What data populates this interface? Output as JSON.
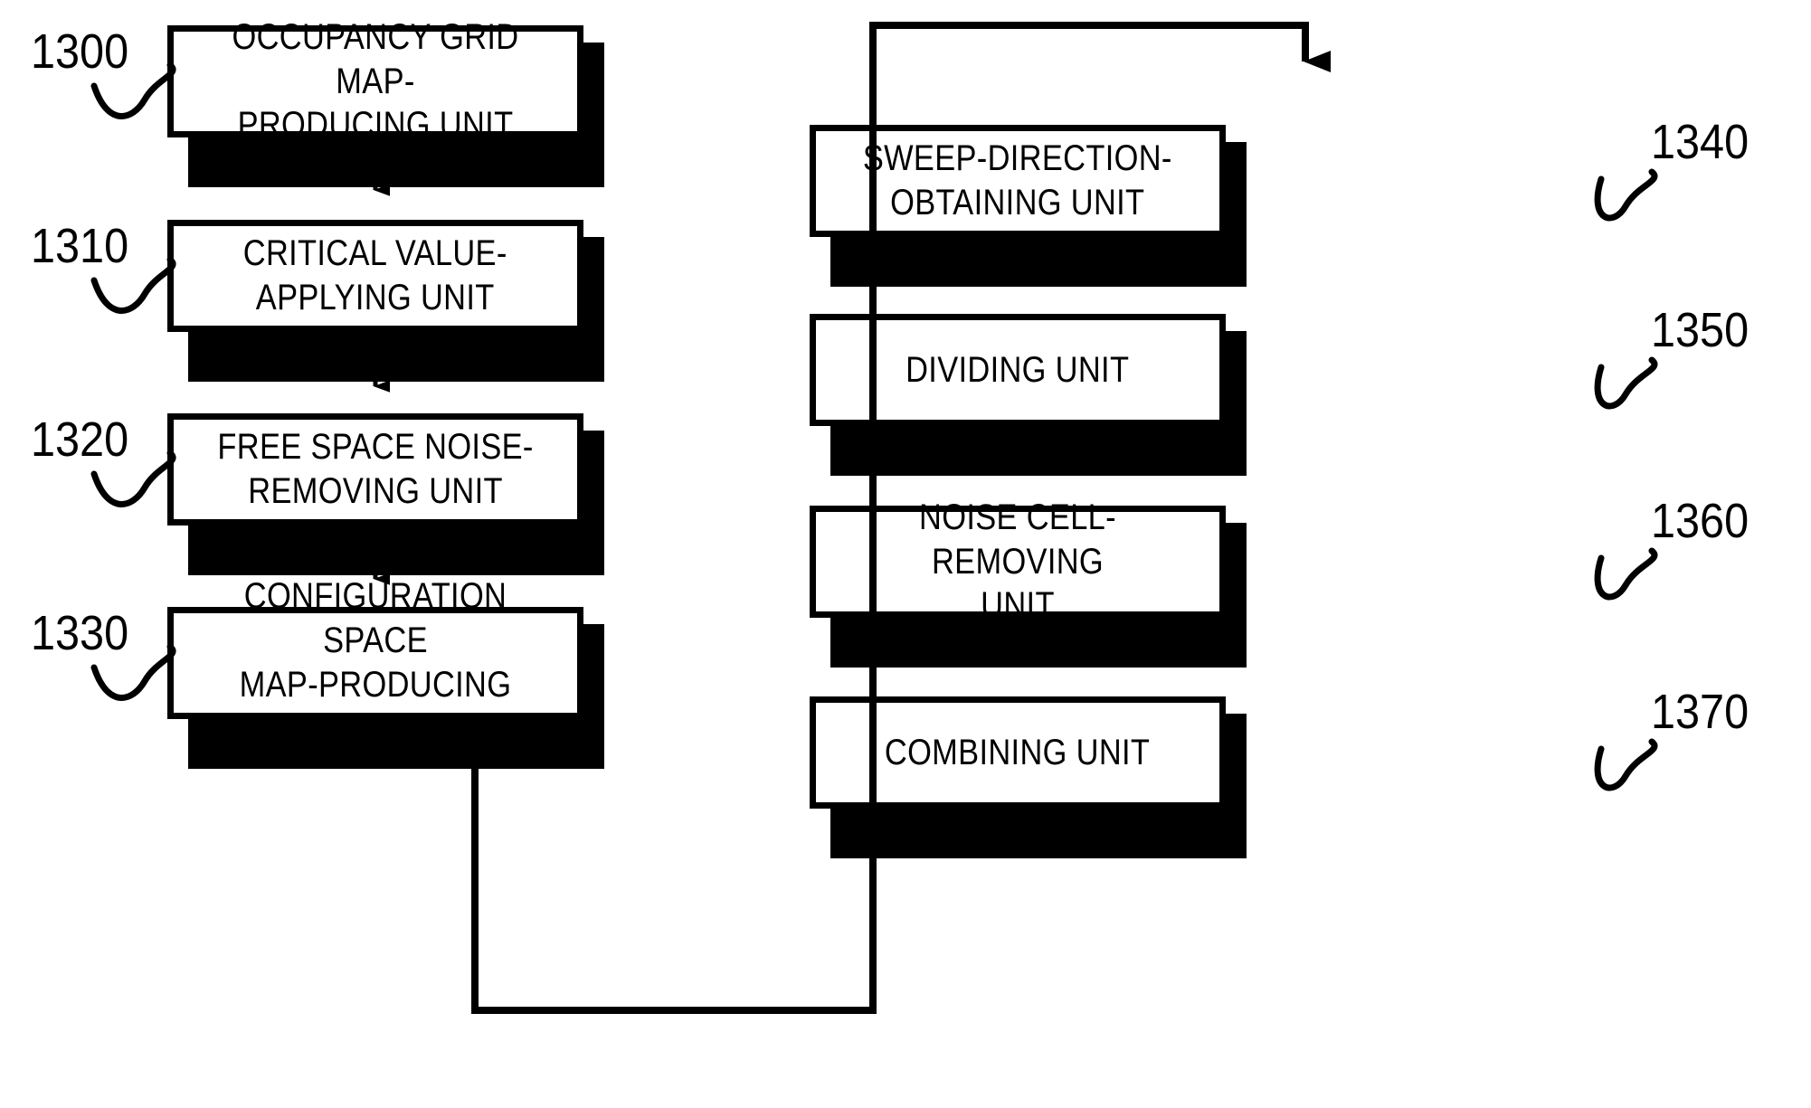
{
  "figure": {
    "type": "patent-block-diagram",
    "orientation": "two-column-vertical-flow",
    "colors": {
      "ink": "#000000",
      "paper": "#ffffff"
    }
  },
  "left_column": {
    "nodes": [
      {
        "ref": "1300",
        "label": "OCCUPANCY GRID MAP-\nPRODUCING UNIT"
      },
      {
        "ref": "1310",
        "label": "CRITICAL VALUE-\nAPPLYING UNIT"
      },
      {
        "ref": "1320",
        "label": "FREE SPACE NOISE-\nREMOVING UNIT"
      },
      {
        "ref": "1330",
        "label": "CONFIGURATION SPACE\nMAP-PRODUCING UNIT"
      }
    ]
  },
  "right_column": {
    "nodes": [
      {
        "ref": "1340",
        "label": "SWEEP-DIRECTION-\nOBTAINING UNIT"
      },
      {
        "ref": "1350",
        "label": "DIVIDING UNIT"
      },
      {
        "ref": "1360",
        "label": "NOISE CELL-REMOVING\nUNIT"
      },
      {
        "ref": "1370",
        "label": "COMBINING UNIT"
      }
    ]
  },
  "connections": [
    {
      "from": "1300",
      "to": "1310",
      "style": "arrow-down"
    },
    {
      "from": "1310",
      "to": "1320",
      "style": "arrow-down"
    },
    {
      "from": "1320",
      "to": "1330",
      "style": "arrow-down"
    },
    {
      "from": "1330",
      "to": "1340",
      "style": "routed-feedback-arrow"
    },
    {
      "from": "1340",
      "to": "1350",
      "style": "arrow-down"
    },
    {
      "from": "1350",
      "to": "1360",
      "style": "arrow-down"
    },
    {
      "from": "1360",
      "to": "1370",
      "style": "arrow-down"
    }
  ]
}
